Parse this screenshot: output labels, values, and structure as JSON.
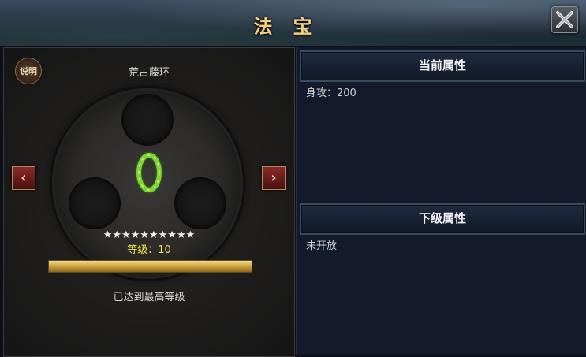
{
  "title": "法宝",
  "close_icon": "close-icon",
  "left": {
    "help_label": "说明",
    "item_name": "荒古藤环",
    "stars": "★★★★★★★★★★",
    "star_count": 10,
    "level_text": "等级：10",
    "progress_fraction": 1.0,
    "max_text": "已达到最高等级",
    "prev_arrow": "‹",
    "next_arrow": "›"
  },
  "right": {
    "current_header": "当前属性",
    "current_value": "身攻：200",
    "next_header": "下级属性",
    "next_value": "未开放"
  },
  "colors": {
    "title_gold": "#f2cf83",
    "level_yellow": "#f3e34a",
    "ring_green": "#7fd33a",
    "right_bg": "#121a2c"
  }
}
